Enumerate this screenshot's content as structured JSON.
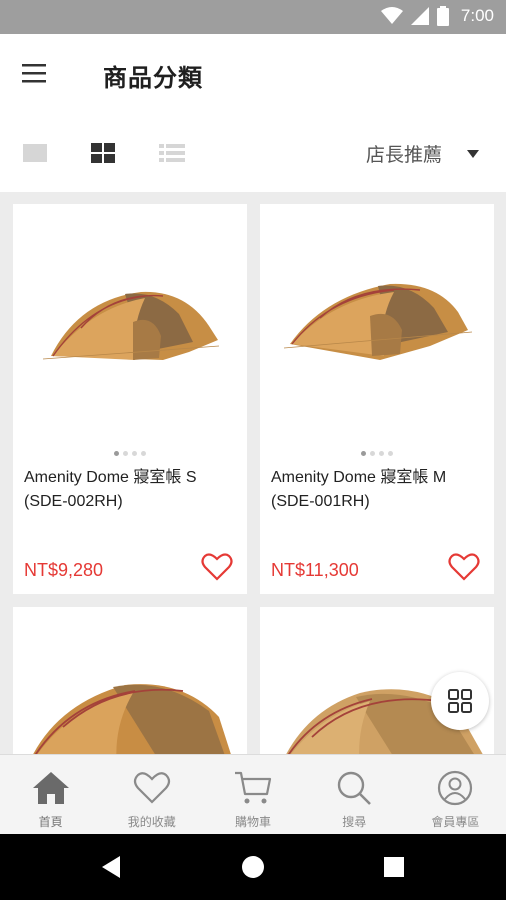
{
  "status_bar": {
    "time": "7:00",
    "icons": [
      "wifi-icon",
      "cellular-signal-icon",
      "battery-icon"
    ]
  },
  "app_bar": {
    "title": "商品分類",
    "menu_icon": "hamburger-menu-icon"
  },
  "toolbar": {
    "view_modes": [
      "single-view-icon",
      "grid-view-icon",
      "list-view-icon"
    ],
    "active_view": "grid-view-icon",
    "sort_selected": "店長推薦"
  },
  "products": [
    {
      "name": "Amenity Dome 寢室帳 S (SDE-002RH)",
      "price": "NT$9,280",
      "image_dots": 4,
      "active_dot": 0
    },
    {
      "name": "Amenity Dome 寢室帳 M (SDE-001RH)",
      "price": "NT$11,300",
      "image_dots": 4,
      "active_dot": 0
    },
    {
      "name": "",
      "price": ""
    },
    {
      "name": "",
      "price": ""
    }
  ],
  "bottom_nav": {
    "items": [
      {
        "label": "首頁",
        "icon": "home-icon",
        "active": true
      },
      {
        "label": "我的收藏",
        "icon": "heart-icon",
        "active": false
      },
      {
        "label": "購物車",
        "icon": "cart-icon",
        "active": false
      },
      {
        "label": "搜尋",
        "icon": "search-icon",
        "active": false
      },
      {
        "label": "會員專區",
        "icon": "user-icon",
        "active": false
      }
    ]
  },
  "colors": {
    "price": "#e53935",
    "tent_body": "#d8a25a",
    "status_bar": "#9e9e9e",
    "system_nav": "#000000"
  }
}
